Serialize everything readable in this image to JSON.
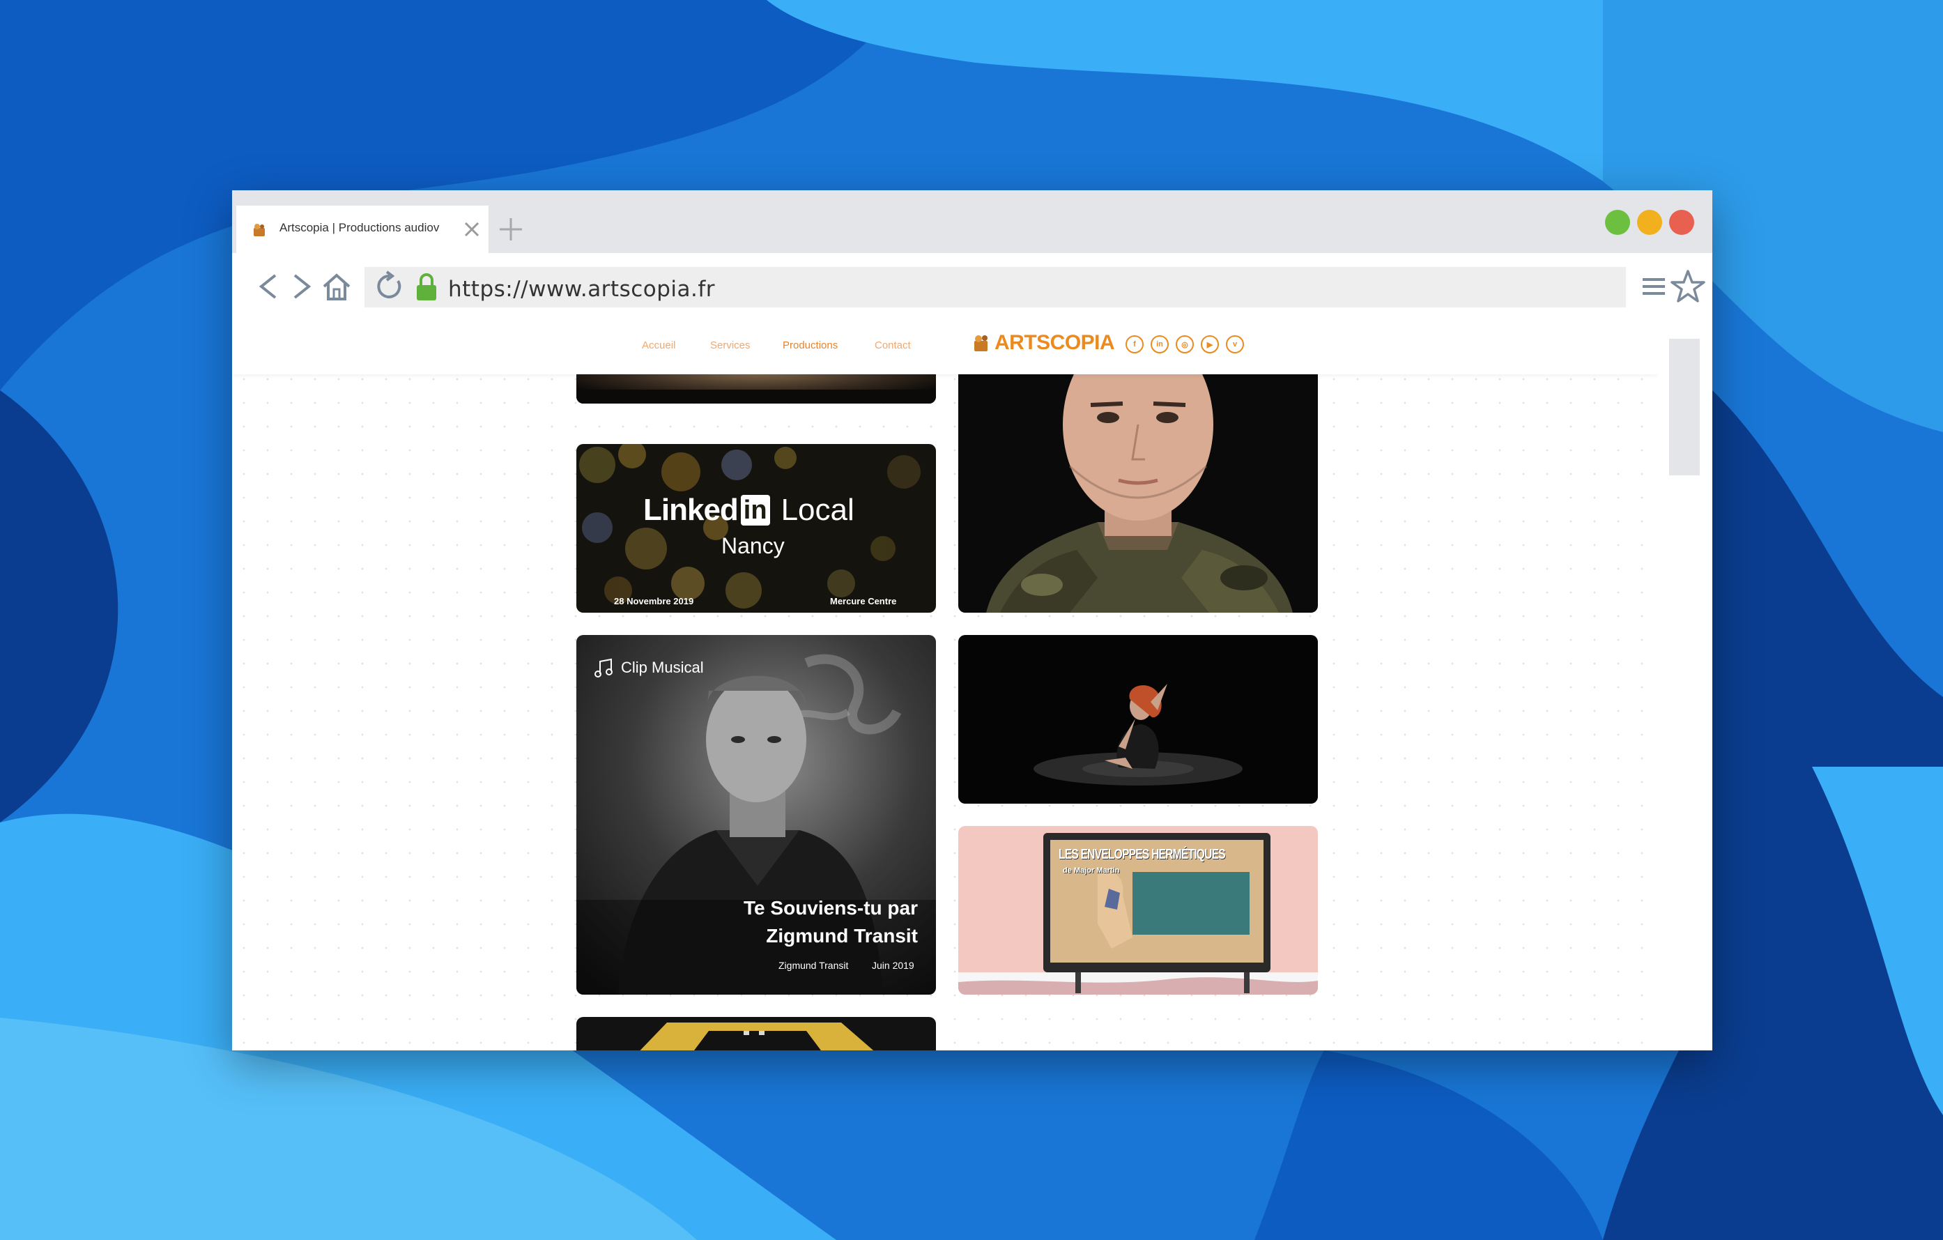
{
  "browser": {
    "tab_title": "Artscopia | Productions audiov",
    "url": "https://www.artscopia.fr"
  },
  "site": {
    "nav": [
      {
        "label": "Accueil"
      },
      {
        "label": "Services"
      },
      {
        "label": "Productions"
      },
      {
        "label": "Contact"
      }
    ],
    "logo_text": "ARTSCOPIA",
    "social": [
      "facebook-icon",
      "linkedin-icon",
      "instagram-icon",
      "youtube-icon",
      "vimeo-icon"
    ]
  },
  "cards": {
    "linkedin": {
      "brand": "Linked",
      "in": "in",
      "local": "Local",
      "city": "Nancy",
      "date": "28 Novembre 2019",
      "venue": "Mercure Centre"
    },
    "clip": {
      "category": "Clip Musical",
      "title_line1": "Te Souviens-tu par",
      "title_line2": "Zigmund Transit",
      "artist": "Zigmund Transit",
      "date": "Juin 2019"
    },
    "billboard": {
      "title": "LES ENVELOPPES HERMÉTIQUES",
      "subtitle": "de Major Martin"
    }
  },
  "colors": {
    "accent": "#ea8a1f",
    "nav_link": "#f0a870",
    "dot_green": "#6cbf3f",
    "dot_yellow": "#f2b01e",
    "dot_red": "#e8604f",
    "lock": "#5fb13b"
  }
}
